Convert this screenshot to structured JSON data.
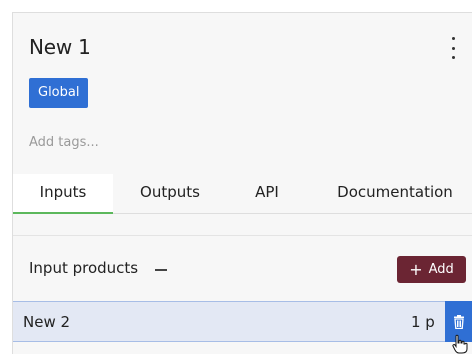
{
  "header": {
    "title": "New 1",
    "menu_icon": "vertical-ellipsis-icon"
  },
  "badge": {
    "label": "Global",
    "color": "#2f6fd4"
  },
  "tags": {
    "placeholder": "Add tags..."
  },
  "tabs": [
    {
      "label": "Inputs",
      "active": true
    },
    {
      "label": "Outputs",
      "active": false
    },
    {
      "label": "API",
      "active": false
    },
    {
      "label": "Documentation",
      "active": false
    }
  ],
  "inputs_section": {
    "title": "Input products",
    "collapse_icon": "minus-icon",
    "add_label": "Add",
    "add_icon": "plus-icon",
    "add_color": "#6b2533"
  },
  "products": [
    {
      "name": "New 2",
      "quantity": "1 p",
      "delete_icon": "trash-icon"
    }
  ],
  "colors": {
    "accent": "#2f6fd4",
    "active_tab_underline": "#5cb85c",
    "selected_row": "#e3e8f4"
  }
}
